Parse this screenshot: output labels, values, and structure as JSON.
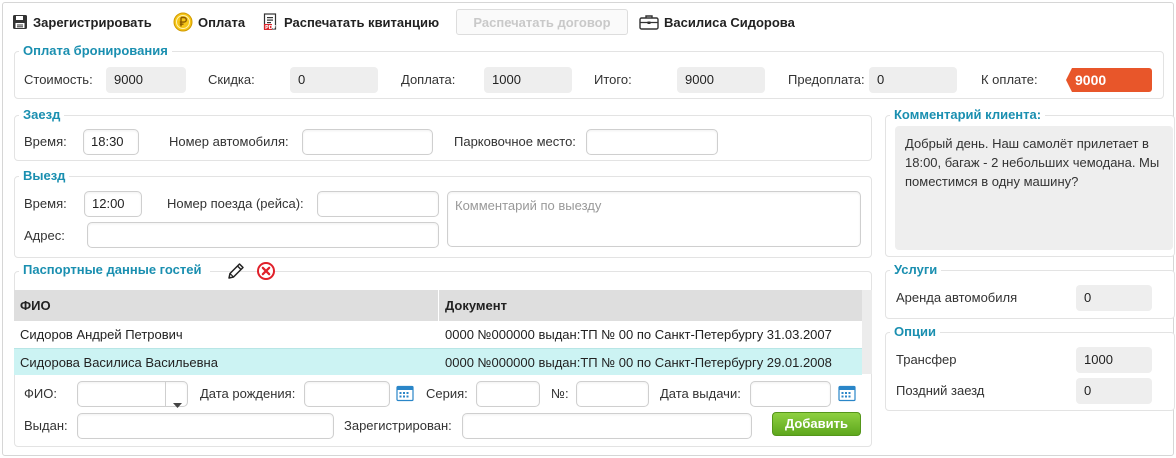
{
  "toolbar": {
    "register_label": "Зарегистрировать",
    "payment_label": "Оплата",
    "print_receipt_label": "Распечатать квитанцию",
    "print_contract_label": "Распечатать договор",
    "guest_name": "Василиса Сидорова"
  },
  "payment": {
    "title": "Оплата бронирования",
    "cost_label": "Стоимость:",
    "cost_value": "9000",
    "discount_label": "Скидка:",
    "discount_value": "0",
    "surcharge_label": "Доплата:",
    "surcharge_value": "1000",
    "total_label": "Итого:",
    "total_value": "9000",
    "prepay_label": "Предоплата:",
    "prepay_value": "0",
    "topay_label": "К оплате:",
    "topay_value": "9000",
    "accent": "#e8562a"
  },
  "checkin": {
    "title": "Заезд",
    "time_label": "Время:",
    "time_value": "18:30",
    "car_label": "Номер автомобиля:",
    "car_value": "",
    "parking_label": "Парковочное место:",
    "parking_value": ""
  },
  "checkout": {
    "title": "Выезд",
    "time_label": "Время:",
    "time_value": "12:00",
    "train_label": "Номер поезда (рейса):",
    "train_value": "",
    "comment_placeholder": "Комментарий по выезду",
    "address_label": "Адрес:",
    "address_value": ""
  },
  "client_comment": {
    "title": "Комментарий клиента:",
    "text": "Добрый день. Наш самолёт прилетает в 18:00, багаж - 2 небольших чемодана. Мы поместимся в одну машину?"
  },
  "services": {
    "title": "Услуги",
    "items": [
      {
        "name": "Аренда автомобиля",
        "value": "0"
      }
    ]
  },
  "options": {
    "title": "Опции",
    "items": [
      {
        "name": "Трансфер",
        "value": "1000"
      },
      {
        "name": "Поздний заезд",
        "value": "0"
      }
    ]
  },
  "guests": {
    "title": "Паспортные данные гостей",
    "columns": [
      "ФИО",
      "Документ"
    ],
    "rows": [
      {
        "name": "Сидоров Андрей Петрович",
        "document": "0000 №000000 выдан:ТП № 00 по Санкт-Петербургу 31.03.2007"
      },
      {
        "name": "Сидорова Василиса Васильевна",
        "document": "0000 №000000 выдан:ТП № 00 по Санкт-Петербургу 29.01.2008"
      }
    ],
    "selected_row_color": "#ccf3f3",
    "form": {
      "fio_label": "ФИО:",
      "birth_label": "Дата рождения:",
      "series_label": "Серия:",
      "number_label": "№:",
      "issue_date_label": "Дата выдачи:",
      "issued_by_label": "Выдан:",
      "registered_label": "Зарегистрирован:",
      "add_button": "Добавить"
    }
  },
  "colors": {
    "title_blue": "#1a8fb0",
    "add_green": "#6db829"
  }
}
